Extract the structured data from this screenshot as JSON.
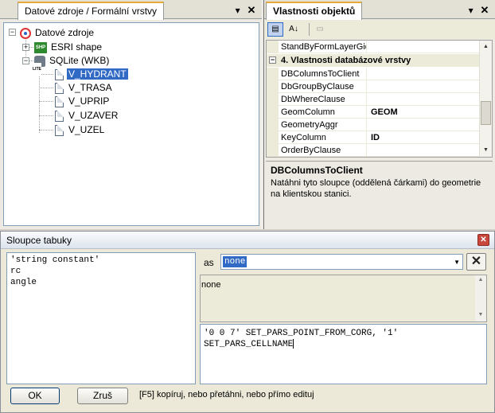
{
  "left_panel": {
    "tab_label": "Datové zdroje / Formální vrstvy",
    "pin_glyph": "▾",
    "close_glyph": "✕",
    "tree": {
      "root": "Datové zdroje",
      "shape": "ESRI shape",
      "sqlite": "SQLite (WKB)",
      "shp_icon_text": "SHP",
      "tables": [
        "V_HYDRANT",
        "V_TRASA",
        "V_UPRIP",
        "V_UZAVER",
        "V_UZEL"
      ]
    }
  },
  "right_panel": {
    "tab_label": "Vlastnosti objektů",
    "pin_glyph": "▾",
    "close_glyph": "✕",
    "properties": [
      {
        "name": "StandByFormLayerGid",
        "value": ""
      },
      {
        "category": "4. Vlastnosti databázové vrstvy"
      },
      {
        "name": "DBColumnsToClient",
        "value": ""
      },
      {
        "name": "DbGroupByClause",
        "value": ""
      },
      {
        "name": "DbWhereClause",
        "value": ""
      },
      {
        "name": "GeomColumn",
        "value": "GEOM"
      },
      {
        "name": "GeometryAggr",
        "value": ""
      },
      {
        "name": "KeyColumn",
        "value": "ID"
      },
      {
        "name": "OrderByClause",
        "value": ""
      }
    ],
    "description": {
      "title": "DBColumnsToClient",
      "text": "Natáhni tyto sloupce (oddělená čárkami) do geometrie na klientskou stanici."
    }
  },
  "dialog": {
    "title": "Sloupce tabuky",
    "columns": [
      "'string constant'",
      "rc",
      "angle"
    ],
    "as_label": "as",
    "as_value": "none",
    "info_text": "none",
    "code_lines": [
      "'0 0 7' SET_PARS_POINT_FROM_CORG, '1'",
      "SET_PARS_CELLNAME"
    ],
    "ok_label": "OK",
    "cancel_label": "Zruš",
    "hint": "[F5] kopíruj, nebo přetáhni, nebo přímo edituj"
  }
}
